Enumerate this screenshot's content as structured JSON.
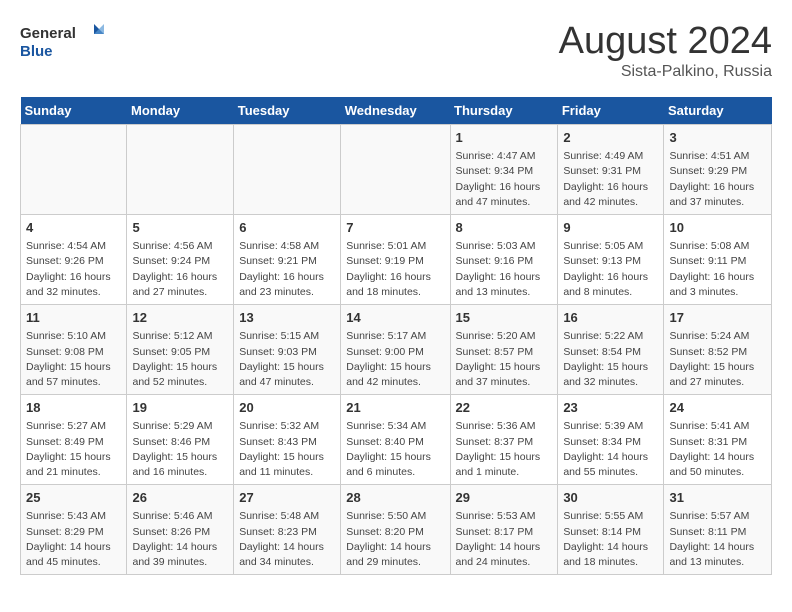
{
  "logo": {
    "general": "General",
    "blue": "Blue"
  },
  "title": {
    "month": "August 2024",
    "location": "Sista-Palkino, Russia"
  },
  "weekdays": [
    "Sunday",
    "Monday",
    "Tuesday",
    "Wednesday",
    "Thursday",
    "Friday",
    "Saturday"
  ],
  "weeks": [
    [
      {
        "day": "",
        "info": ""
      },
      {
        "day": "",
        "info": ""
      },
      {
        "day": "",
        "info": ""
      },
      {
        "day": "",
        "info": ""
      },
      {
        "day": "1",
        "info": "Sunrise: 4:47 AM\nSunset: 9:34 PM\nDaylight: 16 hours and 47 minutes."
      },
      {
        "day": "2",
        "info": "Sunrise: 4:49 AM\nSunset: 9:31 PM\nDaylight: 16 hours and 42 minutes."
      },
      {
        "day": "3",
        "info": "Sunrise: 4:51 AM\nSunset: 9:29 PM\nDaylight: 16 hours and 37 minutes."
      }
    ],
    [
      {
        "day": "4",
        "info": "Sunrise: 4:54 AM\nSunset: 9:26 PM\nDaylight: 16 hours and 32 minutes."
      },
      {
        "day": "5",
        "info": "Sunrise: 4:56 AM\nSunset: 9:24 PM\nDaylight: 16 hours and 27 minutes."
      },
      {
        "day": "6",
        "info": "Sunrise: 4:58 AM\nSunset: 9:21 PM\nDaylight: 16 hours and 23 minutes."
      },
      {
        "day": "7",
        "info": "Sunrise: 5:01 AM\nSunset: 9:19 PM\nDaylight: 16 hours and 18 minutes."
      },
      {
        "day": "8",
        "info": "Sunrise: 5:03 AM\nSunset: 9:16 PM\nDaylight: 16 hours and 13 minutes."
      },
      {
        "day": "9",
        "info": "Sunrise: 5:05 AM\nSunset: 9:13 PM\nDaylight: 16 hours and 8 minutes."
      },
      {
        "day": "10",
        "info": "Sunrise: 5:08 AM\nSunset: 9:11 PM\nDaylight: 16 hours and 3 minutes."
      }
    ],
    [
      {
        "day": "11",
        "info": "Sunrise: 5:10 AM\nSunset: 9:08 PM\nDaylight: 15 hours and 57 minutes."
      },
      {
        "day": "12",
        "info": "Sunrise: 5:12 AM\nSunset: 9:05 PM\nDaylight: 15 hours and 52 minutes."
      },
      {
        "day": "13",
        "info": "Sunrise: 5:15 AM\nSunset: 9:03 PM\nDaylight: 15 hours and 47 minutes."
      },
      {
        "day": "14",
        "info": "Sunrise: 5:17 AM\nSunset: 9:00 PM\nDaylight: 15 hours and 42 minutes."
      },
      {
        "day": "15",
        "info": "Sunrise: 5:20 AM\nSunset: 8:57 PM\nDaylight: 15 hours and 37 minutes."
      },
      {
        "day": "16",
        "info": "Sunrise: 5:22 AM\nSunset: 8:54 PM\nDaylight: 15 hours and 32 minutes."
      },
      {
        "day": "17",
        "info": "Sunrise: 5:24 AM\nSunset: 8:52 PM\nDaylight: 15 hours and 27 minutes."
      }
    ],
    [
      {
        "day": "18",
        "info": "Sunrise: 5:27 AM\nSunset: 8:49 PM\nDaylight: 15 hours and 21 minutes."
      },
      {
        "day": "19",
        "info": "Sunrise: 5:29 AM\nSunset: 8:46 PM\nDaylight: 15 hours and 16 minutes."
      },
      {
        "day": "20",
        "info": "Sunrise: 5:32 AM\nSunset: 8:43 PM\nDaylight: 15 hours and 11 minutes."
      },
      {
        "day": "21",
        "info": "Sunrise: 5:34 AM\nSunset: 8:40 PM\nDaylight: 15 hours and 6 minutes."
      },
      {
        "day": "22",
        "info": "Sunrise: 5:36 AM\nSunset: 8:37 PM\nDaylight: 15 hours and 1 minute."
      },
      {
        "day": "23",
        "info": "Sunrise: 5:39 AM\nSunset: 8:34 PM\nDaylight: 14 hours and 55 minutes."
      },
      {
        "day": "24",
        "info": "Sunrise: 5:41 AM\nSunset: 8:31 PM\nDaylight: 14 hours and 50 minutes."
      }
    ],
    [
      {
        "day": "25",
        "info": "Sunrise: 5:43 AM\nSunset: 8:29 PM\nDaylight: 14 hours and 45 minutes."
      },
      {
        "day": "26",
        "info": "Sunrise: 5:46 AM\nSunset: 8:26 PM\nDaylight: 14 hours and 39 minutes."
      },
      {
        "day": "27",
        "info": "Sunrise: 5:48 AM\nSunset: 8:23 PM\nDaylight: 14 hours and 34 minutes."
      },
      {
        "day": "28",
        "info": "Sunrise: 5:50 AM\nSunset: 8:20 PM\nDaylight: 14 hours and 29 minutes."
      },
      {
        "day": "29",
        "info": "Sunrise: 5:53 AM\nSunset: 8:17 PM\nDaylight: 14 hours and 24 minutes."
      },
      {
        "day": "30",
        "info": "Sunrise: 5:55 AM\nSunset: 8:14 PM\nDaylight: 14 hours and 18 minutes."
      },
      {
        "day": "31",
        "info": "Sunrise: 5:57 AM\nSunset: 8:11 PM\nDaylight: 14 hours and 13 minutes."
      }
    ]
  ]
}
